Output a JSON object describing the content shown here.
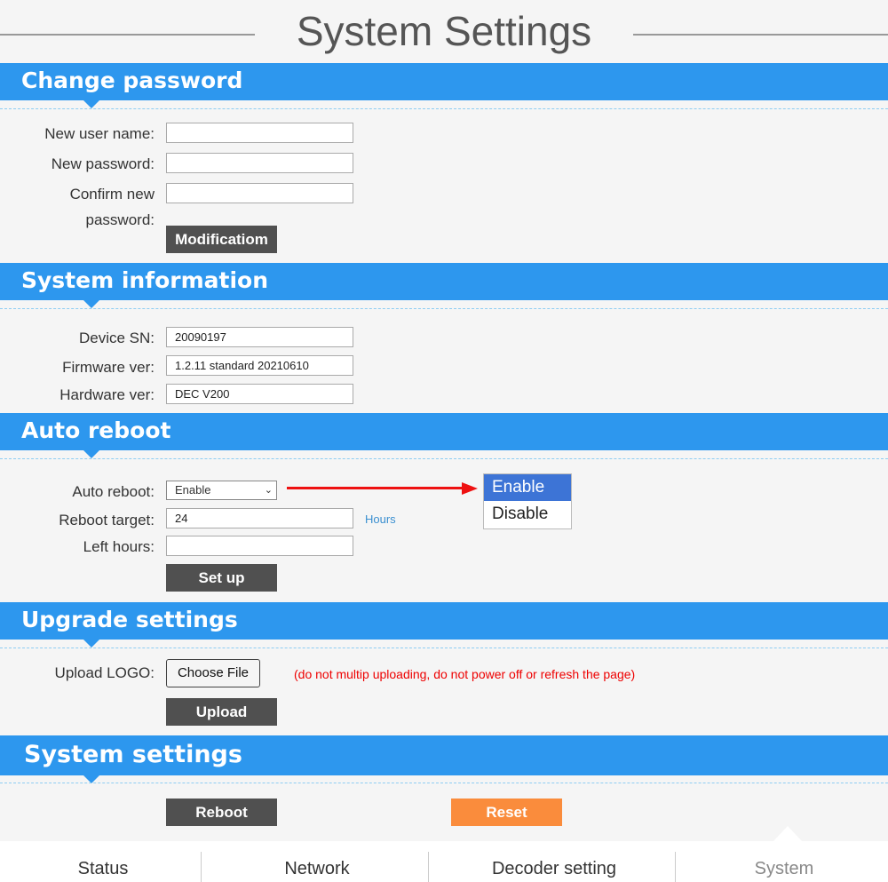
{
  "page": {
    "title": "System Settings"
  },
  "change_password": {
    "header": "Change password",
    "username_label": "New user name:",
    "password_label": "New password:",
    "confirm_label_1": "Confirm new",
    "confirm_label_2": "password:",
    "username_value": "",
    "password_value": "",
    "confirm_value": "",
    "submit_label": "Modificatiom"
  },
  "system_info": {
    "header": "System information",
    "sn_label": "Device SN:",
    "sn_value": "20090197",
    "fw_label": "Firmware ver:",
    "fw_value": "1.2.11 standard 20210610",
    "hw_label": "Hardware ver:",
    "hw_value": "DEC V200"
  },
  "auto_reboot": {
    "header": "Auto reboot",
    "reboot_label": "Auto reboot:",
    "reboot_selected": "Enable",
    "options": [
      "Enable",
      "Disable"
    ],
    "target_label": "Reboot target:",
    "target_value": "24",
    "target_unit": "Hours",
    "left_label": "Left hours:",
    "left_value": "",
    "setup_label": "Set up"
  },
  "upgrade": {
    "header": "Upgrade settings",
    "logo_label": "Upload LOGO:",
    "choose_file_label": "Choose File",
    "warning": "(do not multip uploading, do not power off or refresh the page)",
    "upload_label": "Upload"
  },
  "system_settings": {
    "header": "System settings",
    "reboot_label": "Reboot",
    "reset_label": "Reset"
  },
  "nav": {
    "items": [
      "Status",
      "Network",
      "Decoder setting",
      "System"
    ],
    "active": "System"
  },
  "colors": {
    "header_blue": "#2d97ee",
    "button_dark": "#505050",
    "reset_orange": "#fa8c3c",
    "warning_red": "#e00000",
    "selected_option": "#3d74d6"
  }
}
